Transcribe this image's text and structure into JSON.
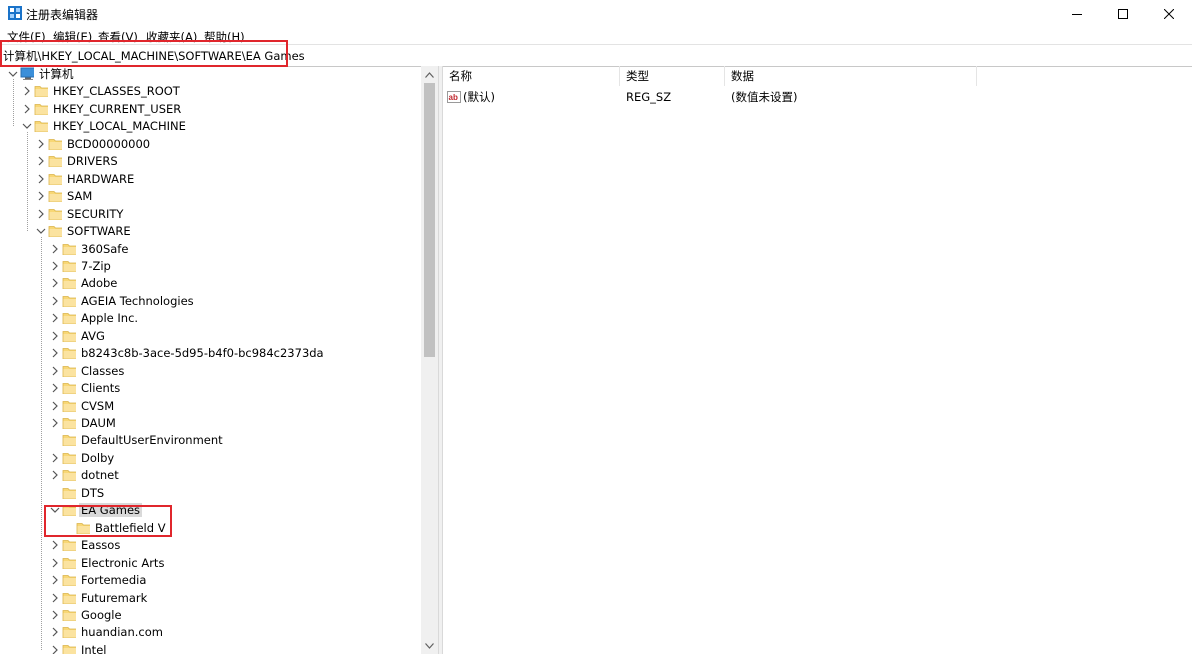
{
  "window": {
    "title": "注册表编辑器"
  },
  "menu": [
    "文件(F)",
    "编辑(E)",
    "查看(V)",
    "收藏夹(A)",
    "帮助(H)"
  ],
  "address": "计算机\\HKEY_LOCAL_MACHINE\\SOFTWARE\\EA Games",
  "tree": {
    "root": "计算机",
    "hives": [
      "HKEY_CLASSES_ROOT",
      "HKEY_CURRENT_USER",
      "HKEY_LOCAL_MACHINE"
    ],
    "hklm": [
      "BCD00000000",
      "DRIVERS",
      "HARDWARE",
      "SAM",
      "SECURITY",
      "SOFTWARE"
    ],
    "software": [
      "360Safe",
      "7-Zip",
      "Adobe",
      "AGEIA Technologies",
      "Apple Inc.",
      "AVG",
      "b8243c8b-3ace-5d95-b4f0-bc984c2373da",
      "Classes",
      "Clients",
      "CVSM",
      "DAUM",
      "DefaultUserEnvironment",
      "Dolby",
      "dotnet",
      "DTS",
      "EA Games",
      "Eassos",
      "Electronic Arts",
      "Fortemedia",
      "Futuremark",
      "Google",
      "huandian.com",
      "Intel"
    ],
    "ea_games": [
      "Battlefield V"
    ]
  },
  "list": {
    "columns": [
      "名称",
      "类型",
      "数据"
    ],
    "rows": [
      {
        "name": "(默认)",
        "type": "REG_SZ",
        "data": "(数值未设置)"
      }
    ]
  }
}
